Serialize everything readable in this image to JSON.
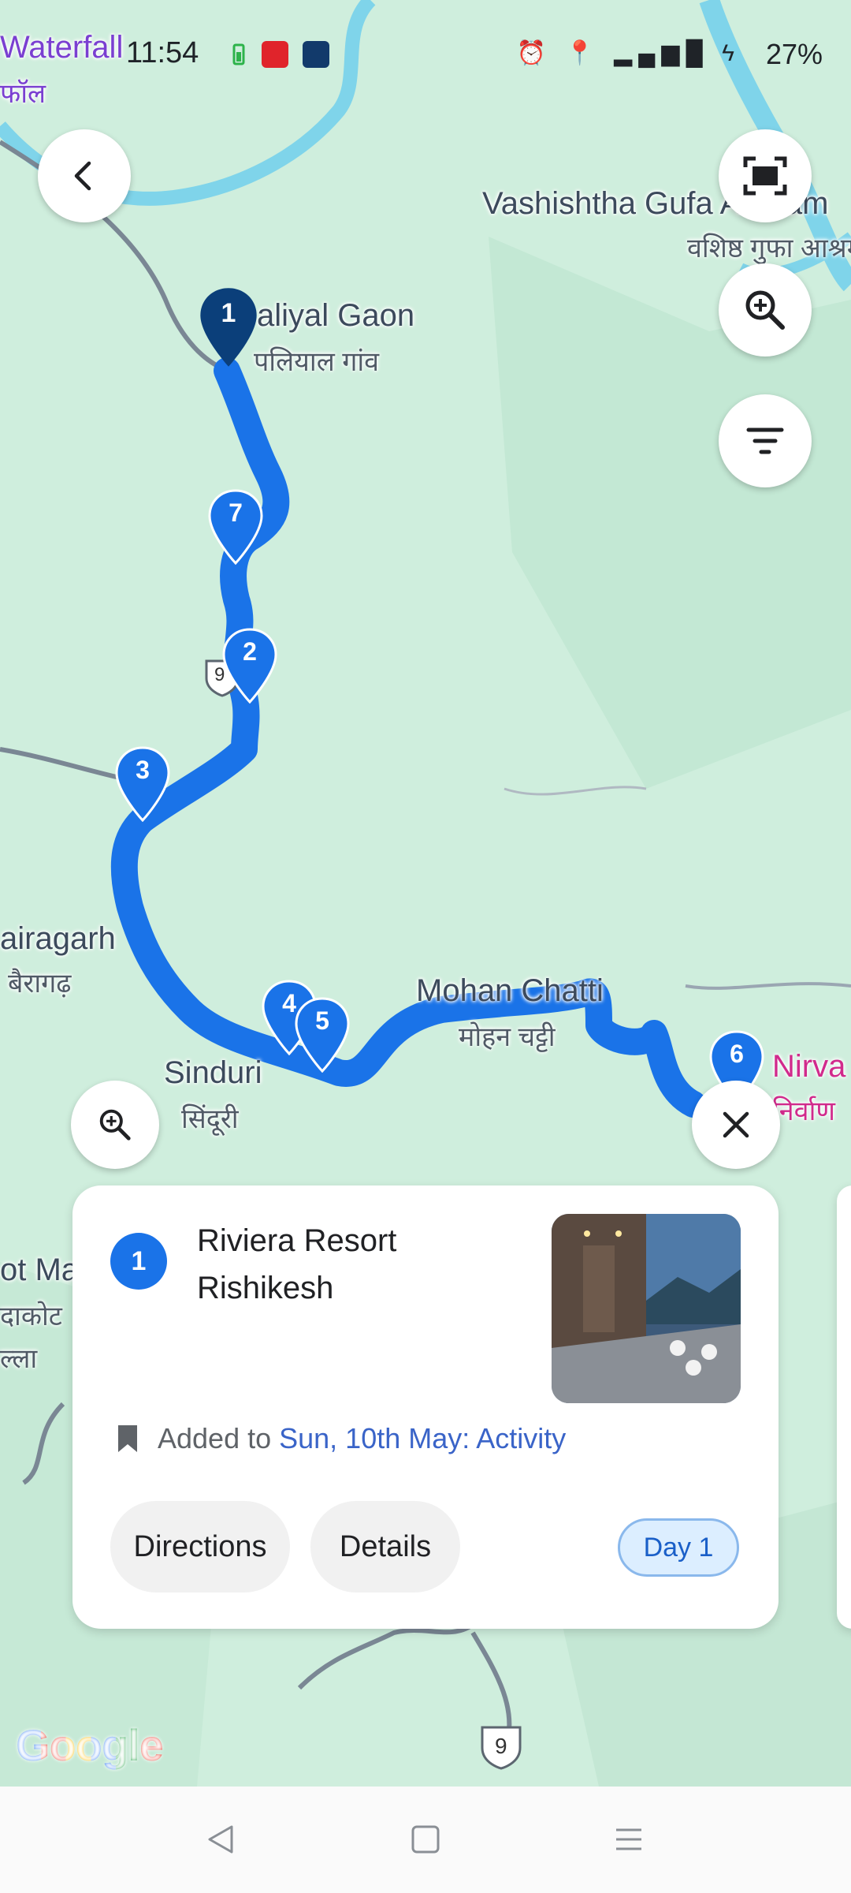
{
  "status_bar": {
    "time": "11:54",
    "battery": "27%",
    "app_icons": [
      "battery-saver-icon",
      "yatra-icon",
      "twin-mind-icon"
    ],
    "system_icons": [
      "alarm-icon",
      "location-icon",
      "volte-icon",
      "signal-5g-icon",
      "charging-icon"
    ]
  },
  "map": {
    "labels": {
      "waterfall": "Waterfall",
      "waterfall_hi": "फॉल",
      "vashishtha": "Vashishtha Gufa Ashram",
      "vashishtha_hi": "वशिष्ठ गुफा आश्रम",
      "paliyal": "aliyal Gaon",
      "paliyal_hi": "पलियाल गांव",
      "bairagarh": "airagarh",
      "bairagarh_hi": "बैरागढ़",
      "mohan_chatti": "Mohan Chatti",
      "mohan_chatti_hi": "मोहन चट्टी",
      "sinduri": "Sinduri",
      "sinduri_hi": "सिंदूरी",
      "nirvana": "Nirva",
      "nirvana_hi": "निर्वाण",
      "kot": "ot Ma",
      "kot_hi1": "दाकोट",
      "kot_hi2": "ल्ला",
      "highway_1": "9",
      "highway_2": "9"
    },
    "pins": [
      {
        "label": "1",
        "selected": true
      },
      {
        "label": "7",
        "selected": false
      },
      {
        "label": "2",
        "selected": false
      },
      {
        "label": "3",
        "selected": false
      },
      {
        "label": "4",
        "selected": false
      },
      {
        "label": "5",
        "selected": false
      },
      {
        "label": "6",
        "selected": false
      }
    ],
    "attribution": "Google"
  },
  "controls": {
    "back_icon": "chevron-left-icon",
    "fullscreen_icon": "fullscreen-icon",
    "zoom_icon": "zoom-in-icon",
    "filter_icon": "filter-icon",
    "card_zoom_icon": "zoom-in-icon",
    "close_icon": "close-icon"
  },
  "card": {
    "number": "1",
    "title": "Riviera Resort Rishikesh",
    "added_prefix": "Added to",
    "added_link": "Sun, 10th May: Activity",
    "directions_label": "Directions",
    "details_label": "Details",
    "day_label": "Day 1"
  },
  "nav_bar": {
    "buttons": [
      "back-nav-icon",
      "home-nav-icon",
      "menu-nav-icon"
    ]
  },
  "colors": {
    "route": "#1a73e8",
    "selected_pin": "#0b3f7a",
    "pin": "#1a73e8",
    "map_bg": "#cdeedd",
    "river": "#7fd4ea"
  }
}
